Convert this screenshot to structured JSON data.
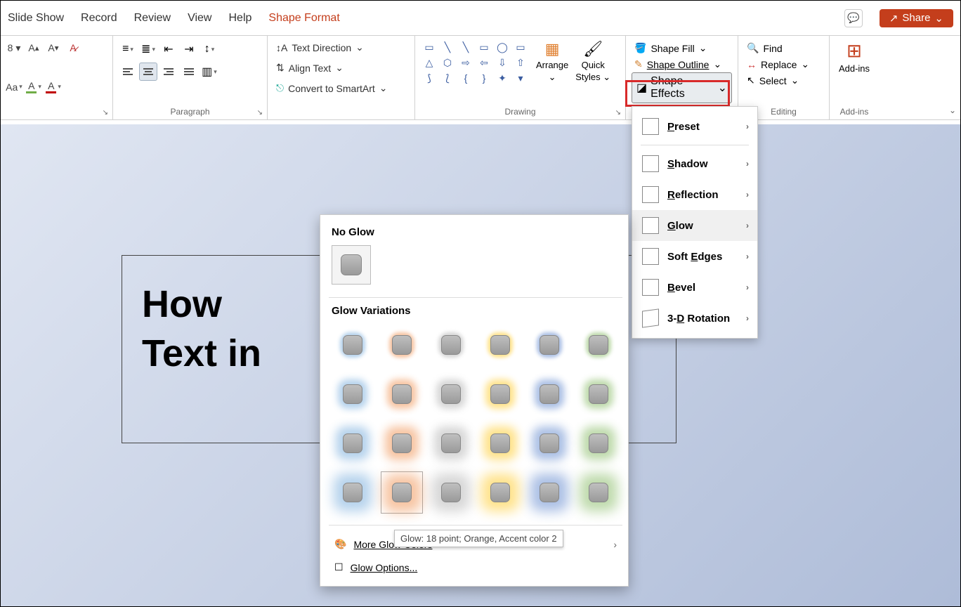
{
  "tabs": {
    "slideshow": "Slide Show",
    "record": "Record",
    "review": "Review",
    "view": "View",
    "help": "Help",
    "shapeformat": "Shape Format"
  },
  "share": "Share",
  "font": {
    "aa": "Aa",
    "fontsize": "8"
  },
  "groups": {
    "paragraph": "Paragraph",
    "drawing": "Drawing",
    "editing": "Editing",
    "addins": "Add-ins"
  },
  "textopts": {
    "direction": "Text Direction",
    "align": "Align Text",
    "smartart": "Convert to SmartArt"
  },
  "arrange": "Arrange",
  "quickstyles_l1": "Quick",
  "quickstyles_l2": "Styles",
  "shapefill": "Shape Fill",
  "shapeoutline": "Shape Outline",
  "shapeeffects": "Shape Effects",
  "find": "Find",
  "replace": "Replace",
  "select": "Select",
  "addins": "Add-ins",
  "slide": {
    "line1": "How",
    "line2": "Text in"
  },
  "effects": {
    "preset": "Preset",
    "shadow": "Shadow",
    "reflection": "Reflection",
    "glow": "Glow",
    "softedges": "Soft Edges",
    "bevel": "Bevel",
    "rotation": "3-D Rotation"
  },
  "glowpanel": {
    "noglow": "No Glow",
    "variations": "Glow Variations",
    "morecolors": "More Glow Colors",
    "options": "Glow Options...",
    "tooltip": "Glow: 18 point; Orange, Accent color 2"
  },
  "glow_colors": [
    "#5b9bd5",
    "#ed7d31",
    "#a5a5a5",
    "#ffc000",
    "#4472c4",
    "#70ad47"
  ],
  "glow_sizes": [
    8,
    14,
    20,
    26
  ]
}
